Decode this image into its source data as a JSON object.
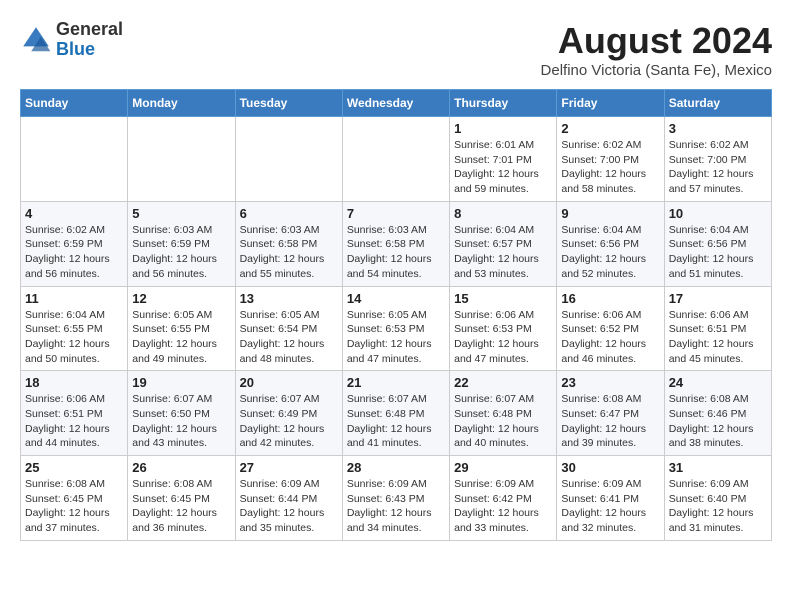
{
  "header": {
    "logo": {
      "general": "General",
      "blue": "Blue"
    },
    "month_year": "August 2024",
    "location": "Delfino Victoria (Santa Fe), Mexico"
  },
  "weekdays": [
    "Sunday",
    "Monday",
    "Tuesday",
    "Wednesday",
    "Thursday",
    "Friday",
    "Saturday"
  ],
  "weeks": [
    [
      {
        "day": "",
        "info": ""
      },
      {
        "day": "",
        "info": ""
      },
      {
        "day": "",
        "info": ""
      },
      {
        "day": "",
        "info": ""
      },
      {
        "day": "1",
        "info": "Sunrise: 6:01 AM\nSunset: 7:01 PM\nDaylight: 12 hours\nand 59 minutes."
      },
      {
        "day": "2",
        "info": "Sunrise: 6:02 AM\nSunset: 7:00 PM\nDaylight: 12 hours\nand 58 minutes."
      },
      {
        "day": "3",
        "info": "Sunrise: 6:02 AM\nSunset: 7:00 PM\nDaylight: 12 hours\nand 57 minutes."
      }
    ],
    [
      {
        "day": "4",
        "info": "Sunrise: 6:02 AM\nSunset: 6:59 PM\nDaylight: 12 hours\nand 56 minutes."
      },
      {
        "day": "5",
        "info": "Sunrise: 6:03 AM\nSunset: 6:59 PM\nDaylight: 12 hours\nand 56 minutes."
      },
      {
        "day": "6",
        "info": "Sunrise: 6:03 AM\nSunset: 6:58 PM\nDaylight: 12 hours\nand 55 minutes."
      },
      {
        "day": "7",
        "info": "Sunrise: 6:03 AM\nSunset: 6:58 PM\nDaylight: 12 hours\nand 54 minutes."
      },
      {
        "day": "8",
        "info": "Sunrise: 6:04 AM\nSunset: 6:57 PM\nDaylight: 12 hours\nand 53 minutes."
      },
      {
        "day": "9",
        "info": "Sunrise: 6:04 AM\nSunset: 6:56 PM\nDaylight: 12 hours\nand 52 minutes."
      },
      {
        "day": "10",
        "info": "Sunrise: 6:04 AM\nSunset: 6:56 PM\nDaylight: 12 hours\nand 51 minutes."
      }
    ],
    [
      {
        "day": "11",
        "info": "Sunrise: 6:04 AM\nSunset: 6:55 PM\nDaylight: 12 hours\nand 50 minutes."
      },
      {
        "day": "12",
        "info": "Sunrise: 6:05 AM\nSunset: 6:55 PM\nDaylight: 12 hours\nand 49 minutes."
      },
      {
        "day": "13",
        "info": "Sunrise: 6:05 AM\nSunset: 6:54 PM\nDaylight: 12 hours\nand 48 minutes."
      },
      {
        "day": "14",
        "info": "Sunrise: 6:05 AM\nSunset: 6:53 PM\nDaylight: 12 hours\nand 47 minutes."
      },
      {
        "day": "15",
        "info": "Sunrise: 6:06 AM\nSunset: 6:53 PM\nDaylight: 12 hours\nand 47 minutes."
      },
      {
        "day": "16",
        "info": "Sunrise: 6:06 AM\nSunset: 6:52 PM\nDaylight: 12 hours\nand 46 minutes."
      },
      {
        "day": "17",
        "info": "Sunrise: 6:06 AM\nSunset: 6:51 PM\nDaylight: 12 hours\nand 45 minutes."
      }
    ],
    [
      {
        "day": "18",
        "info": "Sunrise: 6:06 AM\nSunset: 6:51 PM\nDaylight: 12 hours\nand 44 minutes."
      },
      {
        "day": "19",
        "info": "Sunrise: 6:07 AM\nSunset: 6:50 PM\nDaylight: 12 hours\nand 43 minutes."
      },
      {
        "day": "20",
        "info": "Sunrise: 6:07 AM\nSunset: 6:49 PM\nDaylight: 12 hours\nand 42 minutes."
      },
      {
        "day": "21",
        "info": "Sunrise: 6:07 AM\nSunset: 6:48 PM\nDaylight: 12 hours\nand 41 minutes."
      },
      {
        "day": "22",
        "info": "Sunrise: 6:07 AM\nSunset: 6:48 PM\nDaylight: 12 hours\nand 40 minutes."
      },
      {
        "day": "23",
        "info": "Sunrise: 6:08 AM\nSunset: 6:47 PM\nDaylight: 12 hours\nand 39 minutes."
      },
      {
        "day": "24",
        "info": "Sunrise: 6:08 AM\nSunset: 6:46 PM\nDaylight: 12 hours\nand 38 minutes."
      }
    ],
    [
      {
        "day": "25",
        "info": "Sunrise: 6:08 AM\nSunset: 6:45 PM\nDaylight: 12 hours\nand 37 minutes."
      },
      {
        "day": "26",
        "info": "Sunrise: 6:08 AM\nSunset: 6:45 PM\nDaylight: 12 hours\nand 36 minutes."
      },
      {
        "day": "27",
        "info": "Sunrise: 6:09 AM\nSunset: 6:44 PM\nDaylight: 12 hours\nand 35 minutes."
      },
      {
        "day": "28",
        "info": "Sunrise: 6:09 AM\nSunset: 6:43 PM\nDaylight: 12 hours\nand 34 minutes."
      },
      {
        "day": "29",
        "info": "Sunrise: 6:09 AM\nSunset: 6:42 PM\nDaylight: 12 hours\nand 33 minutes."
      },
      {
        "day": "30",
        "info": "Sunrise: 6:09 AM\nSunset: 6:41 PM\nDaylight: 12 hours\nand 32 minutes."
      },
      {
        "day": "31",
        "info": "Sunrise: 6:09 AM\nSunset: 6:40 PM\nDaylight: 12 hours\nand 31 minutes."
      }
    ]
  ]
}
